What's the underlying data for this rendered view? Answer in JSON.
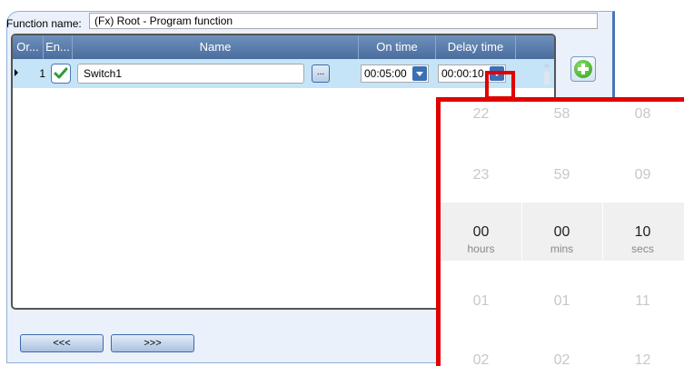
{
  "function": {
    "label": "Function name:",
    "value": "(Fx) Root - Program function"
  },
  "grid": {
    "headers": [
      "Or...",
      "En...",
      "Name",
      "On time",
      "Delay time"
    ],
    "row": {
      "order": "1",
      "enabled": true,
      "name": "Switch1",
      "ellipsis": "...",
      "on_time": "00:05:00",
      "delay_time": "00:00:10"
    }
  },
  "nav": {
    "prev_label": "<<<",
    "next_label": ">>>"
  },
  "picker": {
    "columns": [
      {
        "values": [
          "22",
          "23",
          "00",
          "01",
          "02"
        ],
        "unit": "hours"
      },
      {
        "values": [
          "58",
          "59",
          "00",
          "01",
          "02"
        ],
        "unit": "mins"
      },
      {
        "values": [
          "08",
          "09",
          "10",
          "11",
          "12"
        ],
        "unit": "secs"
      }
    ]
  },
  "colors": {
    "accent": "#3b6fb6",
    "highlight": "#e00000",
    "row_selected": "#c6e4f7",
    "header": "#5a7fb0"
  }
}
